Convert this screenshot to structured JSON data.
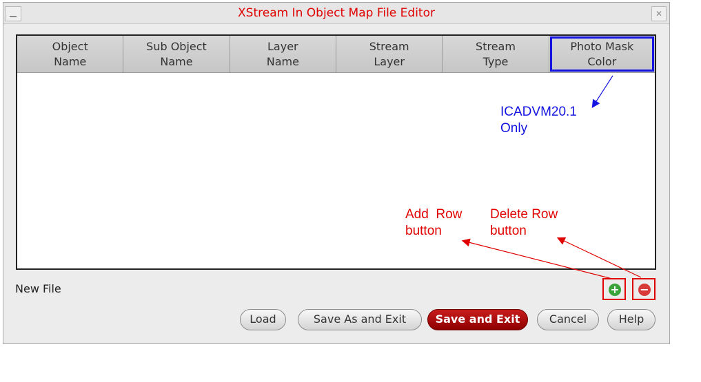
{
  "window": {
    "title": "XStream In Object Map File Editor",
    "close_glyph": "✕"
  },
  "table": {
    "columns": [
      {
        "line1": "Object",
        "line2": "Name"
      },
      {
        "line1": "Sub Object",
        "line2": "Name"
      },
      {
        "line1": "Layer",
        "line2": "Name"
      },
      {
        "line1": "Stream",
        "line2": "Layer"
      },
      {
        "line1": "Stream",
        "line2": "Type"
      },
      {
        "line1": "Photo Mask",
        "line2": "Color"
      }
    ]
  },
  "status": {
    "file_label": "New File"
  },
  "row_buttons": {
    "add_glyph": "+",
    "delete_glyph": "−"
  },
  "buttons": {
    "load": "Load",
    "save_as_exit": "Save As and Exit",
    "save_exit": "Save and Exit",
    "cancel": "Cancel",
    "help": "Help"
  },
  "annotations": {
    "icadvm": {
      "line1": "ICADVM20.1",
      "line2": "Only"
    },
    "add_row": {
      "line1": "Add  Row",
      "line2": "button"
    },
    "delete_row": {
      "line1": "Delete Row",
      "line2": "button"
    }
  },
  "colors": {
    "title_red": "#e00000",
    "annotation_blue": "#1414e0",
    "annotation_red": "#e00000",
    "add_green": "#3aa33a",
    "delete_red": "#d83a3a",
    "primary_button": "#b00000"
  },
  "icons": [
    "minimize-icon",
    "close-icon",
    "add-row-icon",
    "delete-row-icon"
  ]
}
